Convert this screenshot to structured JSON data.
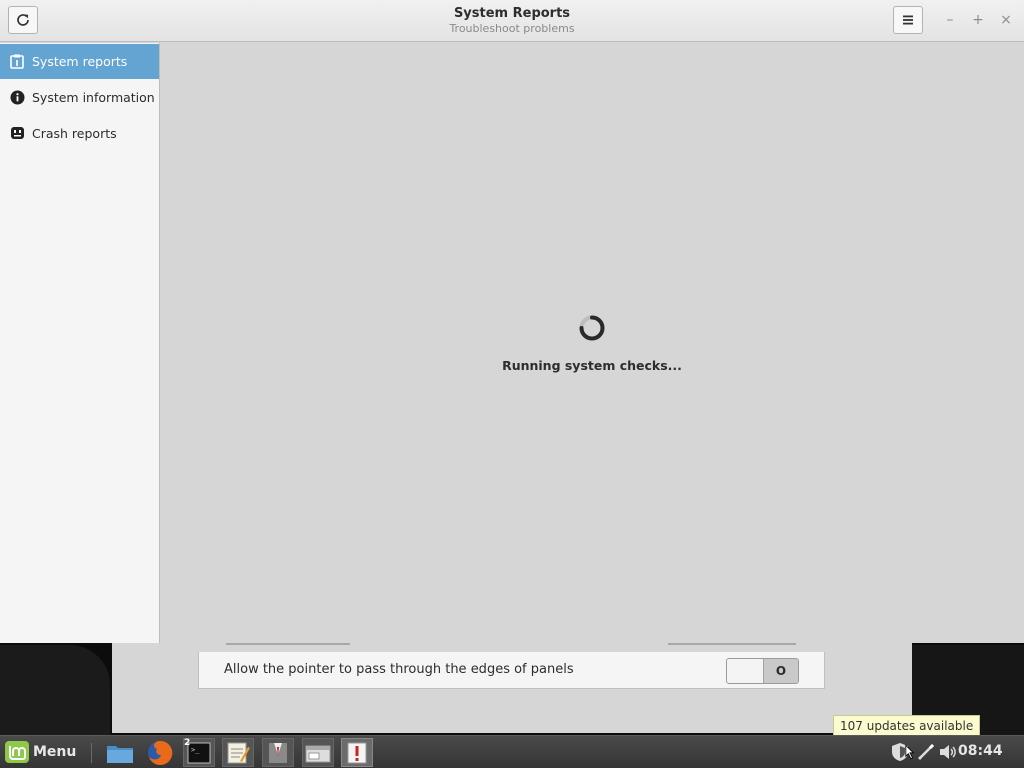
{
  "window": {
    "title": "System Reports",
    "subtitle": "Troubleshoot problems",
    "reload_icon": "reload-icon",
    "menu_icon": "hamburger-icon",
    "min_glyph": "–",
    "max_glyph": "+",
    "close_glyph": "×"
  },
  "sidebar": {
    "items": [
      {
        "label": "System reports",
        "icon": "report-icon",
        "active": true
      },
      {
        "label": "System information",
        "icon": "info-icon",
        "active": false
      },
      {
        "label": "Crash reports",
        "icon": "crash-icon",
        "active": false
      }
    ]
  },
  "content": {
    "status": "Running system checks..."
  },
  "background_window": {
    "row_label": "Allow the pointer to pass through the edges of panels",
    "toggle_value": "O"
  },
  "taskbar": {
    "menu_label": "Menu",
    "terminal_badge": "2",
    "clock": "08:44",
    "tooltip": "107 updates available"
  },
  "colors": {
    "accent": "#64a4d2",
    "tooltip_bg": "#fbfbcf"
  }
}
